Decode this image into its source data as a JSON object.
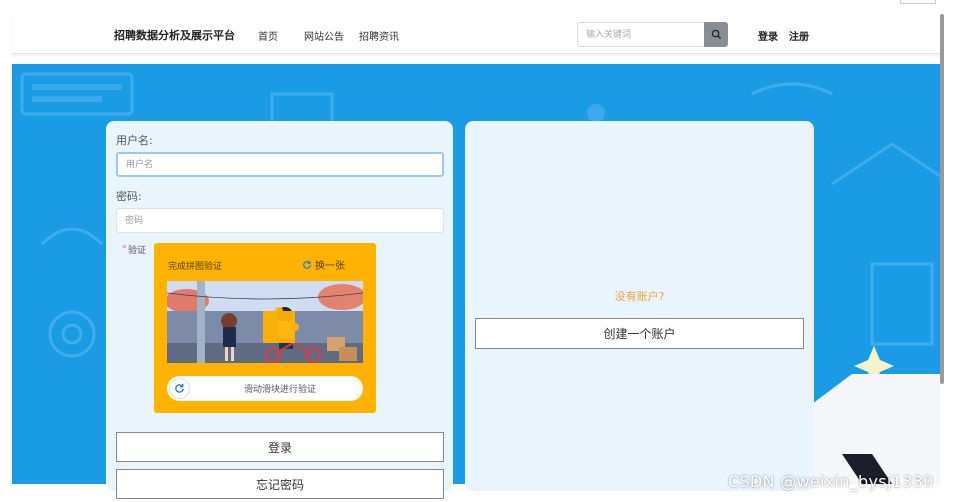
{
  "header": {
    "brand": "招聘数据分析及展示平台",
    "nav": [
      "首页",
      "网站公告",
      "招聘资讯"
    ],
    "search_placeholder": "输入关键词",
    "login_label": "登录",
    "register_label": "注册"
  },
  "login_form": {
    "username_label": "用户名:",
    "username_placeholder": "用户名",
    "password_label": "密码:",
    "password_placeholder": "密码",
    "verify_label": "验证",
    "captcha": {
      "title": "完成拼图验证",
      "refresh_label": "换一张",
      "slider_text": "滑动滑块进行验证"
    },
    "login_button": "登录",
    "forgot_button": "忘记密码"
  },
  "register_panel": {
    "prompt": "没有账户?",
    "create_button": "创建一个账户"
  },
  "watermark": "CSDN @weixin_bysj1330",
  "colors": {
    "background_blue": "#1a9be6",
    "card_bg": "#eaf4fc",
    "captcha_bg": "#ffb300",
    "prompt_orange": "#f0a33c"
  }
}
